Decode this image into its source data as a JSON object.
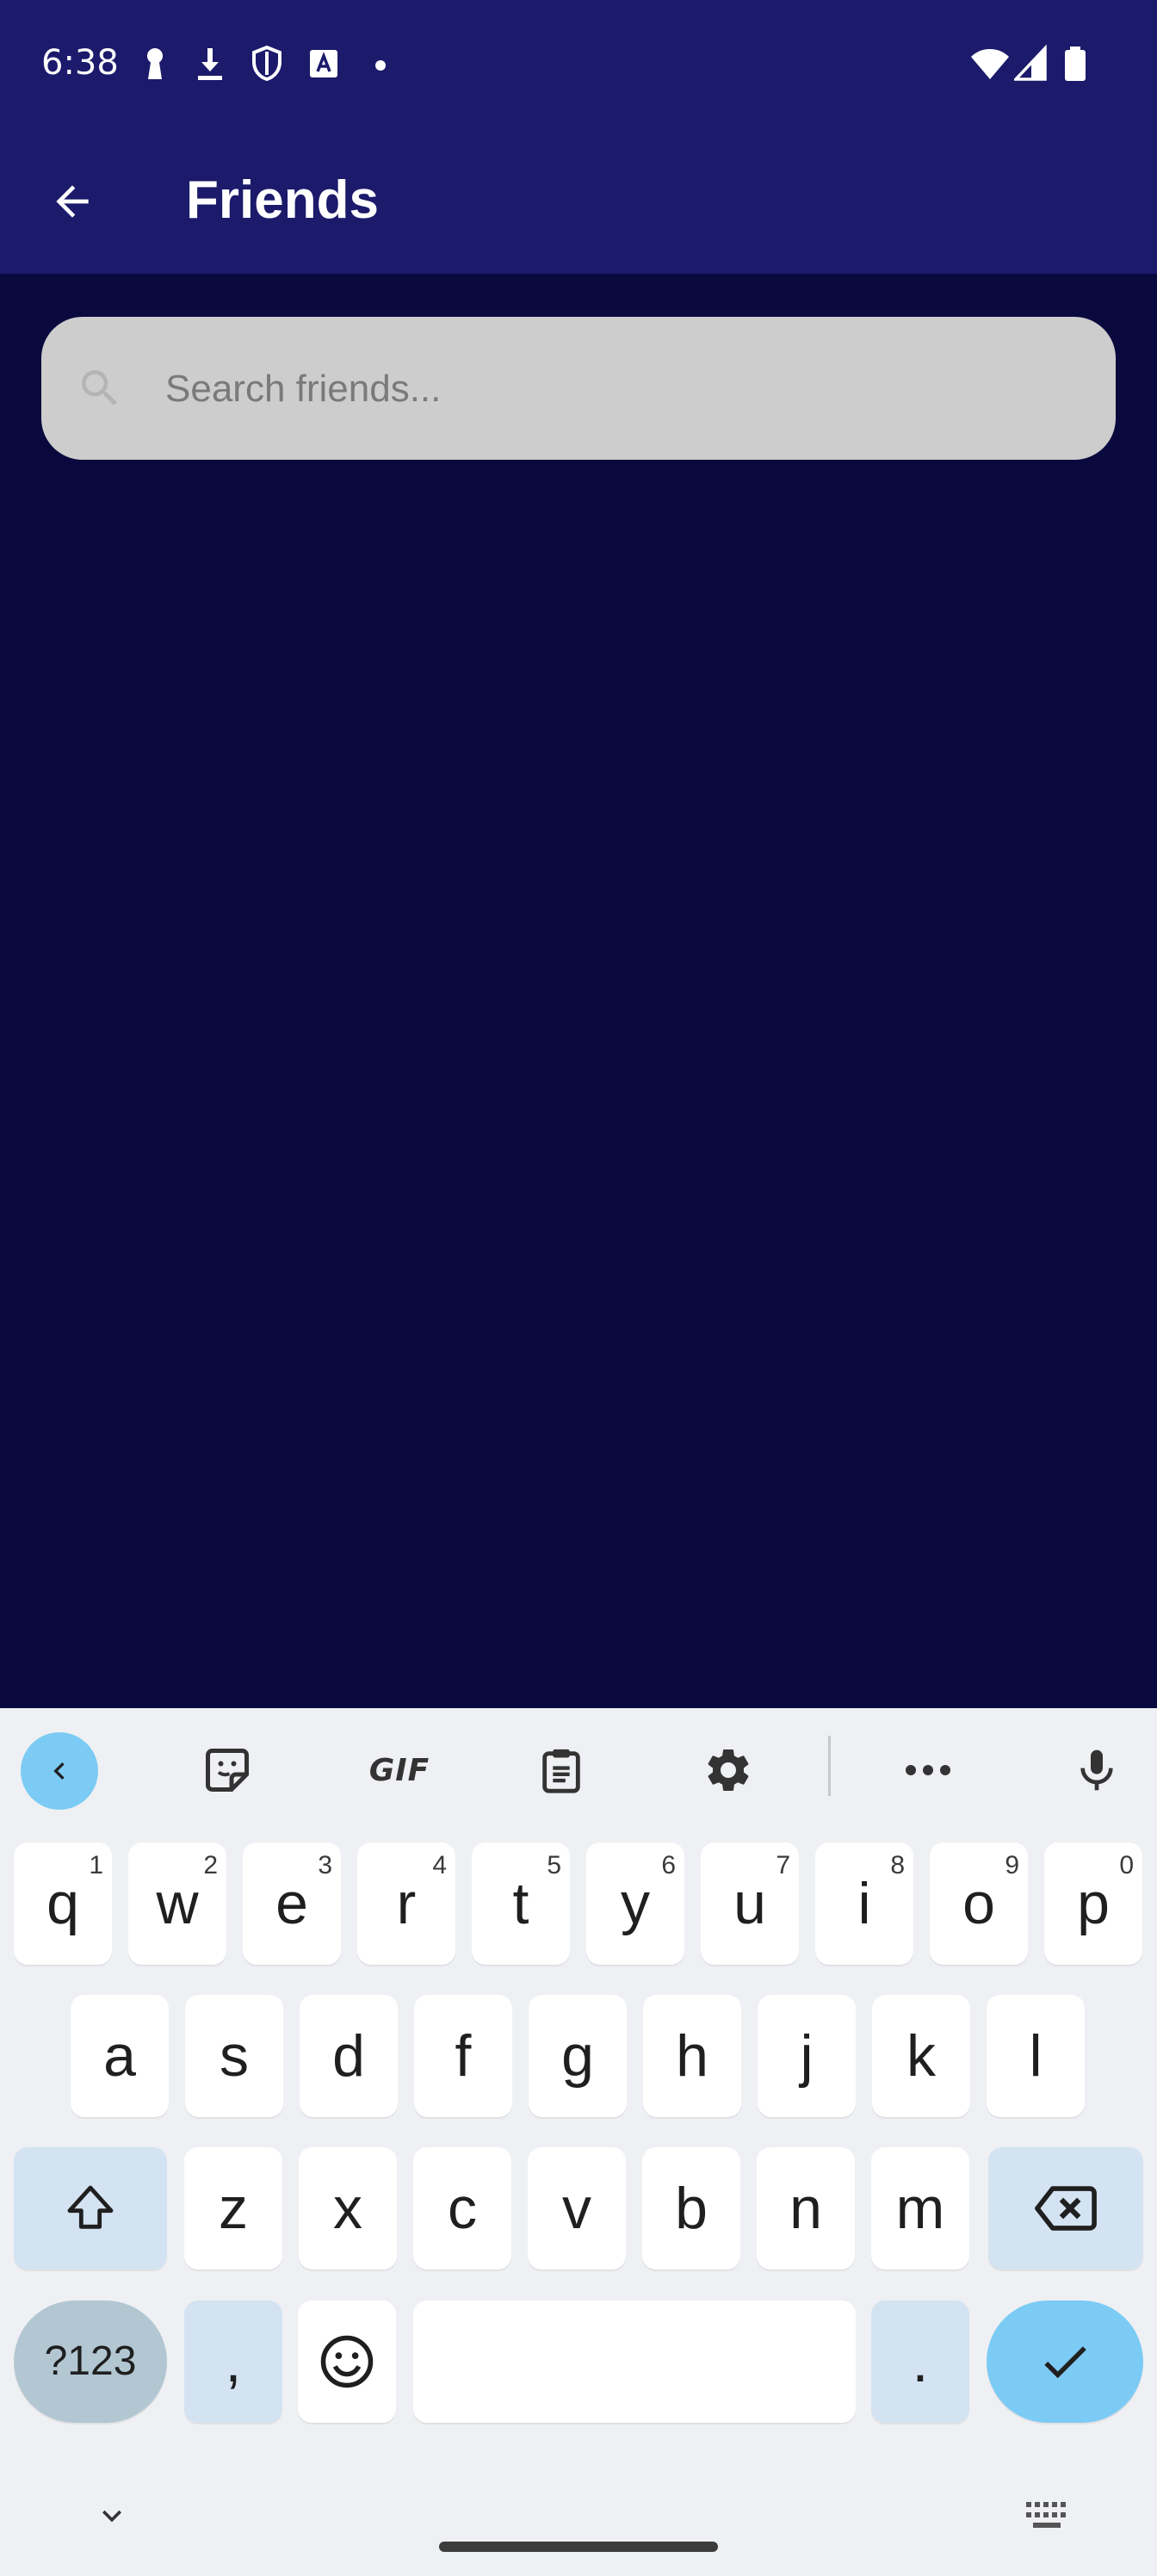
{
  "status_bar": {
    "time": "6:38",
    "icons": [
      "keyhole-icon",
      "download-icon",
      "shield-icon",
      "text-icon",
      "dot-icon",
      "wifi-icon",
      "signal-icon",
      "battery-icon"
    ]
  },
  "app_bar": {
    "title": "Friends",
    "back_icon": "arrow-back-icon"
  },
  "search": {
    "placeholder": "Search friends...",
    "value": ""
  },
  "keyboard": {
    "toolbar": {
      "gif_label": "GIF",
      "items": [
        "collapse-icon",
        "sticker-icon",
        "gif",
        "clipboard-icon",
        "settings-icon",
        "more-icon",
        "mic-icon"
      ]
    },
    "row1": [
      {
        "char": "q",
        "hint": "1"
      },
      {
        "char": "w",
        "hint": "2"
      },
      {
        "char": "e",
        "hint": "3"
      },
      {
        "char": "r",
        "hint": "4"
      },
      {
        "char": "t",
        "hint": "5"
      },
      {
        "char": "y",
        "hint": "6"
      },
      {
        "char": "u",
        "hint": "7"
      },
      {
        "char": "i",
        "hint": "8"
      },
      {
        "char": "o",
        "hint": "9"
      },
      {
        "char": "p",
        "hint": "0"
      }
    ],
    "row2": [
      "a",
      "s",
      "d",
      "f",
      "g",
      "h",
      "j",
      "k",
      "l"
    ],
    "row3": [
      "z",
      "x",
      "c",
      "v",
      "b",
      "n",
      "m"
    ],
    "bottom": {
      "symbols_label": "?123",
      "comma": ",",
      "period": "."
    }
  },
  "colors": {
    "header": "#1b1a6b",
    "background": "#0a093d",
    "search_box": "#cdcdcd",
    "accent_key": "#7ccbf5"
  }
}
